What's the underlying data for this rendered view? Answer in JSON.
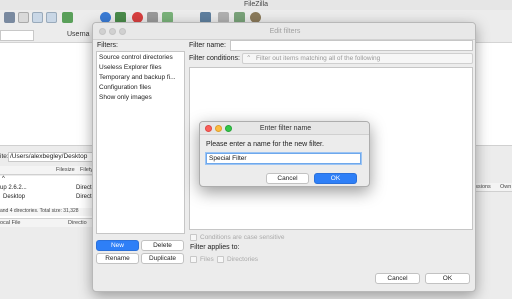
{
  "app": {
    "title": "FileZilla"
  },
  "toolbar": {
    "icons": [
      "site-manager-icon",
      "toggle-log-icon",
      "toggle-tree-icon",
      "toggle-remote-tree-icon",
      "toggle-queue-icon",
      "refresh-icon",
      "process-queue-icon",
      "cancel-icon",
      "disconnect-icon",
      "reconnect-icon",
      "directory-listing-filters-icon",
      "toggle-sync-browsing-icon",
      "compare-icon",
      "search-icon"
    ]
  },
  "quickconnect": {
    "username_label": "Userna"
  },
  "local_site": {
    "label": "ite:",
    "path": "/Users/alexbegley/Desktop",
    "columns": [
      "Filesize",
      "Filety"
    ],
    "rows": [
      {
        "name": "^",
        "type": ""
      },
      {
        "name": "up 2.6.2...",
        "type": "Directo"
      },
      {
        "name": "Desktop",
        "type": "Directo"
      }
    ],
    "status": "and 4 directories. Total size: 31,328"
  },
  "queue": {
    "columns": [
      "ocal File",
      "Directio"
    ]
  },
  "remote": {
    "columns": [
      "issions",
      "Own"
    ]
  },
  "edit_filters": {
    "title": "Edit filters",
    "filters_label": "Filters:",
    "filters": [
      "Source control directories",
      "Useless Explorer files",
      "Temporary and backup fi...",
      "Configuration files",
      "Show only images"
    ],
    "filter_name_label": "Filter name:",
    "filter_name_value": "",
    "filter_conditions_label": "Filter conditions:",
    "filter_conditions_value": "Filter out items matching all of the following",
    "case_sensitive_label": "Conditions are case sensitive",
    "applies_to_label": "Filter applies to:",
    "applies_files_label": "Files",
    "applies_dirs_label": "Directories",
    "new_label": "New",
    "delete_label": "Delete",
    "rename_label": "Rename",
    "duplicate_label": "Duplicate",
    "cancel_label": "Cancel",
    "ok_label": "OK"
  },
  "enter_name": {
    "title": "Enter filter name",
    "prompt": "Please enter a name for the new filter.",
    "value": "Special Filter",
    "cancel_label": "Cancel",
    "ok_label": "OK"
  },
  "colors": {
    "accent": "#2e7ff7",
    "close": "#fc605b",
    "minimize": "#fdbc40",
    "zoom": "#34c84a"
  }
}
